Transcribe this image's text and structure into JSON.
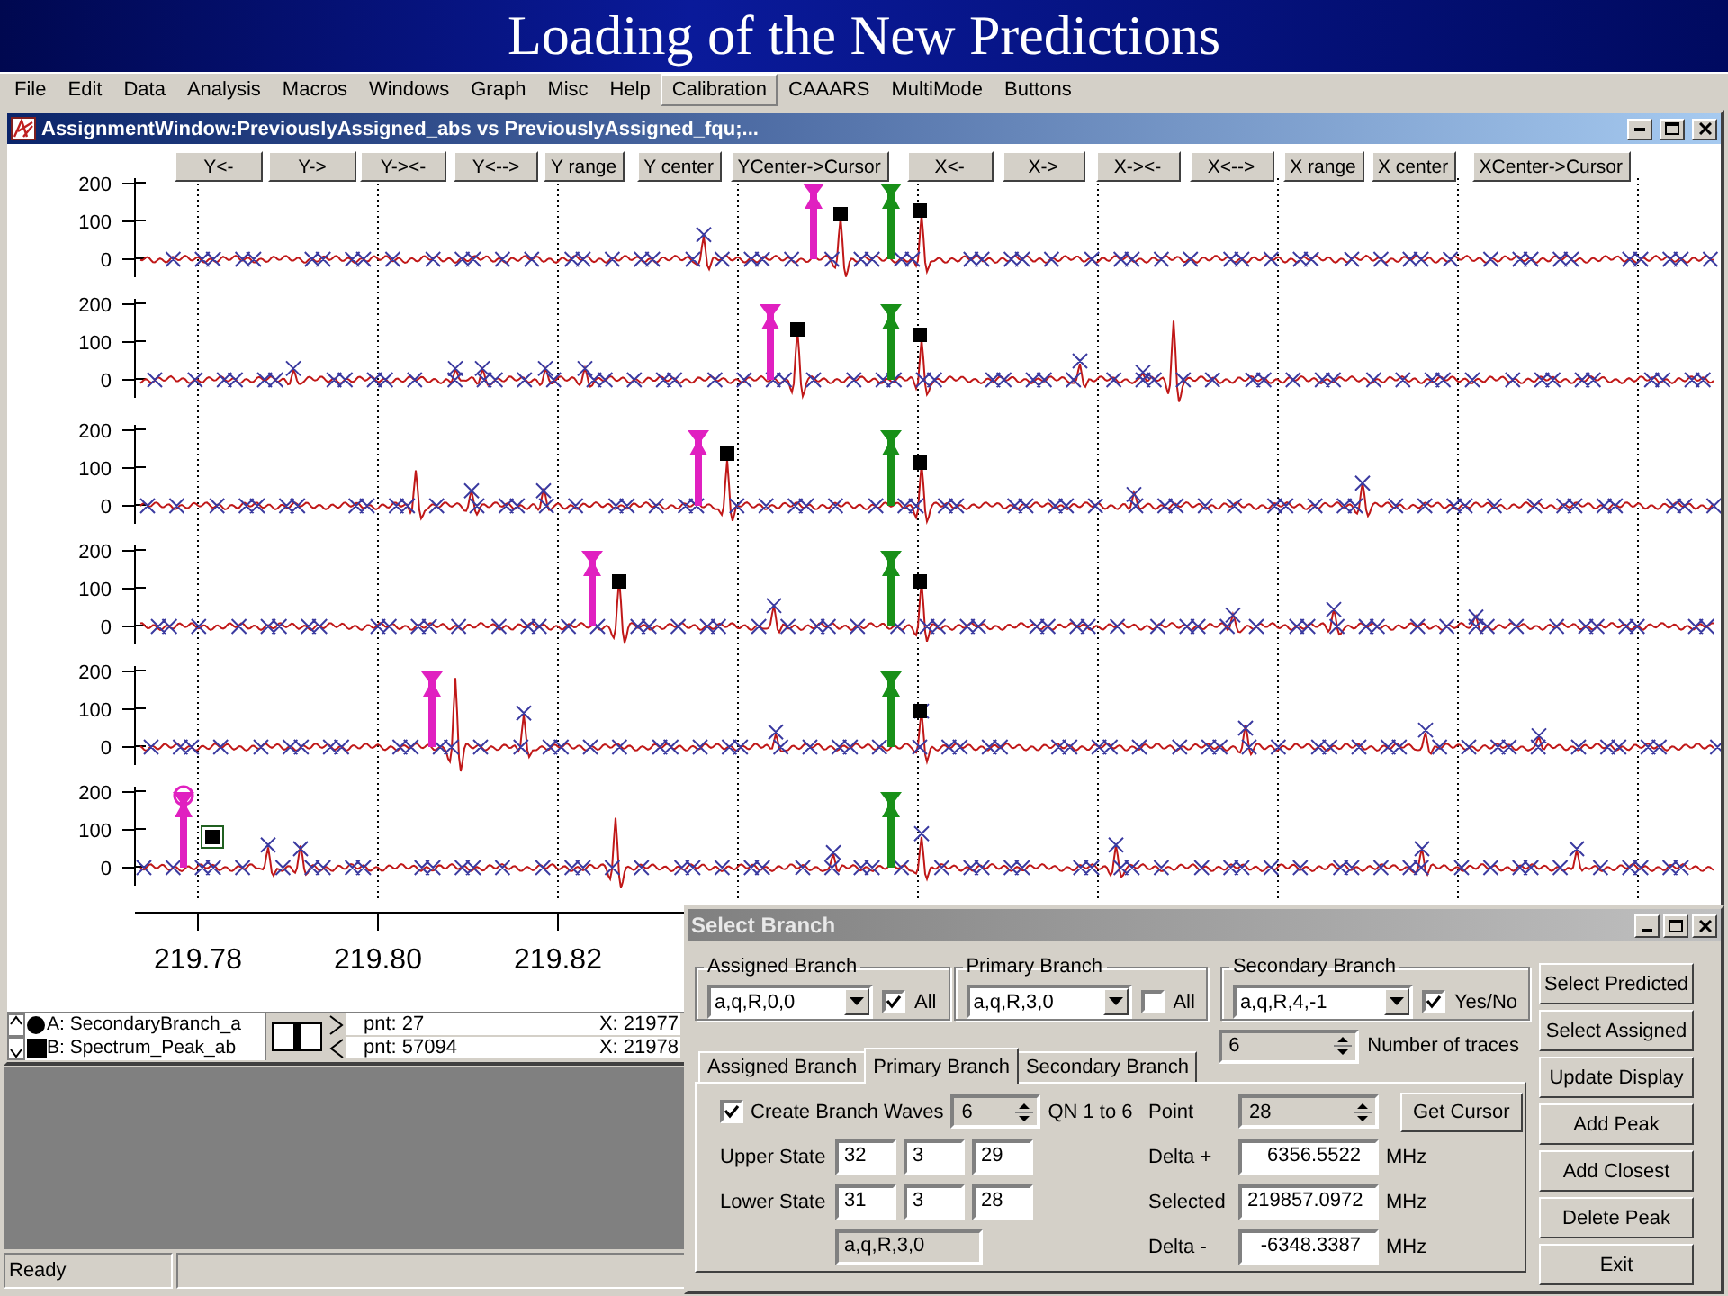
{
  "slide_title": "Loading of the New Predictions",
  "menu": [
    {
      "label": "File",
      "selected": false
    },
    {
      "label": "Edit",
      "selected": false
    },
    {
      "label": "Data",
      "selected": false
    },
    {
      "label": "Analysis",
      "selected": false
    },
    {
      "label": "Macros",
      "selected": false
    },
    {
      "label": "Windows",
      "selected": false
    },
    {
      "label": "Graph",
      "selected": false
    },
    {
      "label": "Misc",
      "selected": false
    },
    {
      "label": "Help",
      "selected": false
    },
    {
      "label": "Calibration",
      "selected": true
    },
    {
      "label": "CAAARS",
      "selected": false
    },
    {
      "label": "MultiMode",
      "selected": false
    },
    {
      "label": "Buttons",
      "selected": false
    }
  ],
  "assignment_window": {
    "title": "AssignmentWindow:PreviouslyAssigned_abs vs PreviouslyAssigned_fqu;...",
    "y_buttons": [
      "Y<-",
      "Y->",
      "Y-><-",
      "Y<-->",
      "Y range",
      "Y center",
      "YCenter->Cursor"
    ],
    "x_buttons": [
      "X<-",
      "X->",
      "X-><-",
      "X<-->",
      "X range",
      "X center",
      "XCenter->Cursor"
    ],
    "traces": [
      {
        "y_ticks": [
          "200",
          "100",
          "0"
        ]
      },
      {
        "y_ticks": [
          "200",
          "100",
          "0"
        ]
      },
      {
        "y_ticks": [
          "200",
          "100",
          "0"
        ]
      },
      {
        "y_ticks": [
          "200",
          "100",
          "0"
        ]
      },
      {
        "y_ticks": [
          "200",
          "100",
          "0"
        ]
      },
      {
        "y_ticks": [
          "200",
          "100",
          "0"
        ]
      }
    ],
    "x_ticks": [
      "219.78",
      "219.80",
      "219.82"
    ],
    "legend": [
      {
        "kind": "circle",
        "label": "A: SecondaryBranch_a",
        "point": "pnt: 27",
        "x": "X: 21977"
      },
      {
        "kind": "square",
        "label": "B: Spectrum_Peak_ab",
        "point": "pnt: 57094",
        "x": "X: 21978"
      }
    ]
  },
  "status_bar": {
    "text": "Ready"
  },
  "dialog": {
    "title": "Select Branch",
    "groups": [
      {
        "label": "Assigned Branch",
        "value": "a,q,R,0,0",
        "check_label": "All",
        "checked": true
      },
      {
        "label": "Primary Branch",
        "value": "a,q,R,3,0",
        "check_label": "All",
        "checked": false
      },
      {
        "label": "Secondary Branch",
        "value": "a,q,R,4,-1",
        "check_label": "Yes/No",
        "checked": true
      }
    ],
    "traces_count": {
      "value": "6",
      "label": "Number of traces"
    },
    "tabs": [
      {
        "label": "Assigned Branch",
        "selected": false
      },
      {
        "label": "Primary Branch",
        "selected": true
      },
      {
        "label": "Secondary Branch",
        "selected": false
      }
    ],
    "create_waves": {
      "label": "Create Branch Waves",
      "checked": true,
      "value": "6",
      "range": "QN 1 to 6"
    },
    "states": [
      {
        "label": "Upper State",
        "values": [
          "32",
          "3",
          "29"
        ]
      },
      {
        "label": "Lower State",
        "values": [
          "31",
          "3",
          "28"
        ]
      }
    ],
    "branch_display": "a,q,R,3,0",
    "point": {
      "label": "Point",
      "value": "28",
      "button": "Get Cursor"
    },
    "frequencies": [
      {
        "label": "Delta +",
        "value": "6356.5522",
        "unit": "MHz"
      },
      {
        "label": "Selected",
        "value": "219857.0972",
        "unit": "MHz"
      },
      {
        "label": "Delta -",
        "value": "-6348.3387",
        "unit": "MHz"
      }
    ],
    "buttons": [
      "Select Predicted",
      "Select Assigned",
      "Update Display",
      "Add Peak",
      "Add Closest",
      "Delete Peak",
      "Exit"
    ]
  }
}
